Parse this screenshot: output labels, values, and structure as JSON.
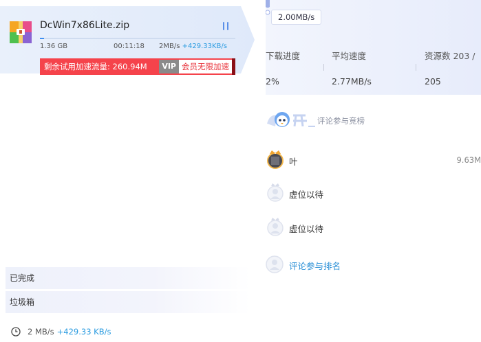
{
  "task": {
    "file_name": "DcWin7x86Lite.zip",
    "file_size": "1.36 GB",
    "remaining_time": "00:11:18",
    "speed": "2MB/s",
    "boost_speed": "+429.33KB/s",
    "progress": 0.02,
    "accel_text": "剩余试用加速流量: 260.94M",
    "vip_label": "VIP",
    "vip_button": "会员无限加速",
    "file_icon": "archive-icon",
    "pause_icon": "pause-icon"
  },
  "sidebar": {
    "items": [
      {
        "label": "已完成"
      },
      {
        "label": "垃圾箱"
      }
    ]
  },
  "footer": {
    "speed": "2 MB/s",
    "boost_speed": "+429.33 KB/s",
    "icon": "clock-icon"
  },
  "details": {
    "speed_tooltip": "2.00MB/s",
    "stats": {
      "headers": [
        "下载进度",
        "平均速度",
        "资源数 203 /"
      ],
      "values": [
        "2%",
        "2.77MB/s",
        "205"
      ]
    },
    "ranking": {
      "subtitle": "评论参与竞榜",
      "rows": [
        {
          "rank": 1,
          "name": "叶",
          "speed": "9.63M"
        },
        {
          "rank": 2,
          "name": "虚位以待",
          "speed": ""
        },
        {
          "rank": 3,
          "name": "虚位以待",
          "speed": ""
        }
      ],
      "join_label": "评论参与排名"
    }
  },
  "colors": {
    "accent_blue": "#3f8ff0",
    "accel_red": "#f5434b",
    "link_blue": "#2a8fd6",
    "boost_blue": "#2a9be0"
  }
}
